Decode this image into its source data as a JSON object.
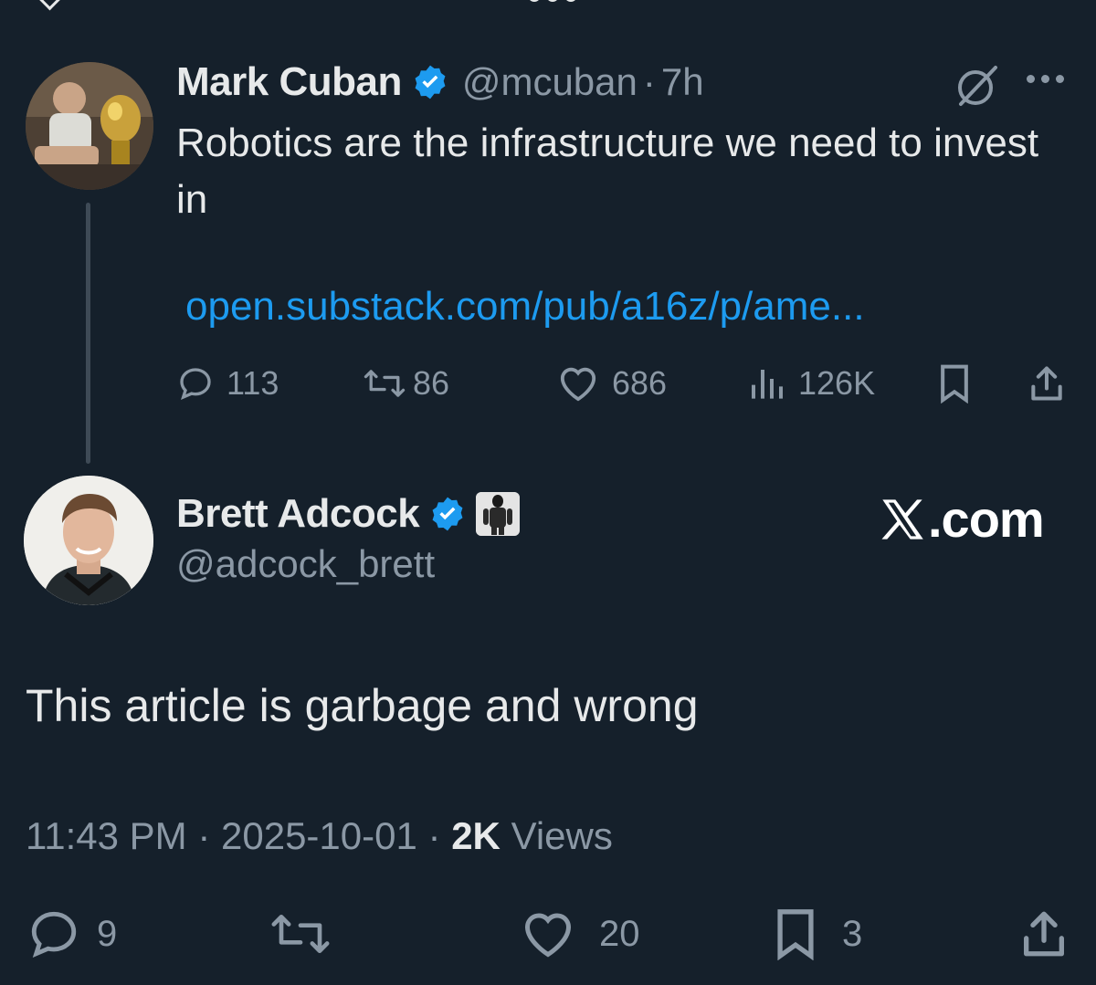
{
  "quoted_tweet": {
    "author_name": "Mark Cuban",
    "handle": "@mcuban",
    "separator": "·",
    "time": "7h",
    "text": "Robotics are the infrastructure we need to invest in",
    "link": "open.substack.com/pub/a16z/p/ame...",
    "stats": {
      "replies": "113",
      "reposts": "86",
      "likes": "686",
      "views": "126K"
    }
  },
  "main_tweet": {
    "author_name": "Brett Adcock",
    "handle": "@adcock_brett",
    "watermark": ".com",
    "text": "This article is garbage and wrong",
    "time": "11:43 PM",
    "separator": "·",
    "date": "2025-10-01",
    "views_count": "2K",
    "views_label": "Views",
    "stats": {
      "replies": "9",
      "likes": "20",
      "bookmarks": "3"
    }
  },
  "colors": {
    "background": "#15202b",
    "text_primary": "#e7e9ea",
    "text_secondary": "#8b98a5",
    "link": "#1d9bf0",
    "verified": "#1d9bf0"
  },
  "icons": {
    "verified": "verified-badge-icon",
    "grok": "grok-icon",
    "more": "more-options-icon",
    "reply": "reply-icon",
    "repost": "repost-icon",
    "like": "like-icon",
    "views": "views-icon",
    "bookmark": "bookmark-icon",
    "share": "share-icon",
    "robot_badge": "robot-badge-icon",
    "x_logo": "x-logo-icon"
  }
}
